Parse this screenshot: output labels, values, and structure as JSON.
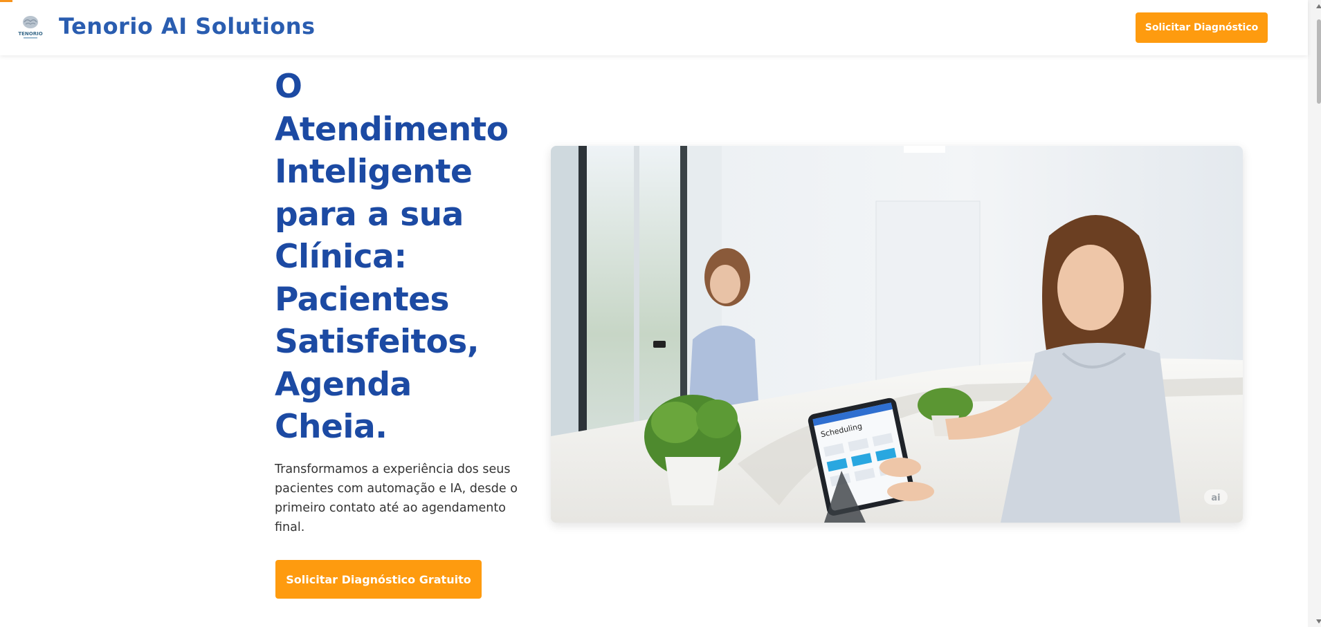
{
  "header": {
    "brand": "Tenorio AI Solutions",
    "logo_text": "TENORIO",
    "cta_label": "Solicitar Diagnóstico"
  },
  "hero": {
    "headline": "O Atendimento Inteligente para a sua Clínica: Pacientes Satisfeitos, Agenda Cheia.",
    "subtext": "Transformamos a experiência dos seus pacientes com automação e IA, desde o primeiro contato até ao agendamento final.",
    "cta_label": "Solicitar Diagnóstico Gratuito",
    "image": {
      "tablet_text": "Scheduling",
      "watermark": "ai"
    }
  },
  "colors": {
    "brand_blue": "#2a5db0",
    "headline_blue": "#1c4aa3",
    "accent_orange": "#fe9b0f"
  },
  "icons": [
    "brain-logo-icon"
  ]
}
